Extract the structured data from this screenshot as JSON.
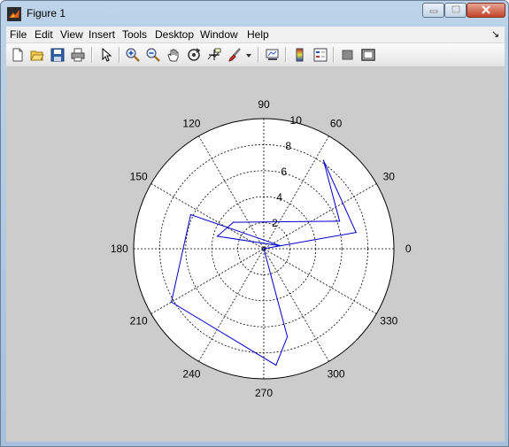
{
  "window": {
    "title": "Figure 1"
  },
  "menu": {
    "items": [
      "File",
      "Edit",
      "View",
      "Insert",
      "Tools",
      "Desktop",
      "Window",
      "Help"
    ],
    "dock_glyph": "↘"
  },
  "toolbar": {
    "buttons": [
      "new-figure-icon",
      "open-file-icon",
      "save-icon",
      "print-icon",
      "pointer-icon",
      "zoom-in-icon",
      "zoom-out-icon",
      "pan-hand-icon",
      "rotate-3d-icon",
      "data-cursor-icon",
      "brush-icon",
      "brush-dropdown-icon",
      "link-plot-icon",
      "colorbar-icon",
      "legend-icon",
      "hide-plot-tools-icon",
      "show-plot-tools-icon"
    ]
  },
  "chart_data": {
    "type": "polar",
    "angle_ticks_deg": [
      0,
      30,
      60,
      90,
      120,
      150,
      180,
      210,
      240,
      270,
      300,
      330
    ],
    "radial_ticks": [
      2,
      4,
      6,
      8,
      10
    ],
    "rmax": 10,
    "grid": true,
    "series": [
      {
        "color": "#0000cc",
        "theta_deg": [
          0,
          10,
          56,
          20,
          139,
          165,
          10,
          155,
          210,
          276,
          285,
          0
        ],
        "r": [
          0,
          7.2,
          8.2,
          6.2,
          3.1,
          3.7,
          1.3,
          6.2,
          8.2,
          9.0,
          7.0,
          0
        ]
      }
    ]
  }
}
